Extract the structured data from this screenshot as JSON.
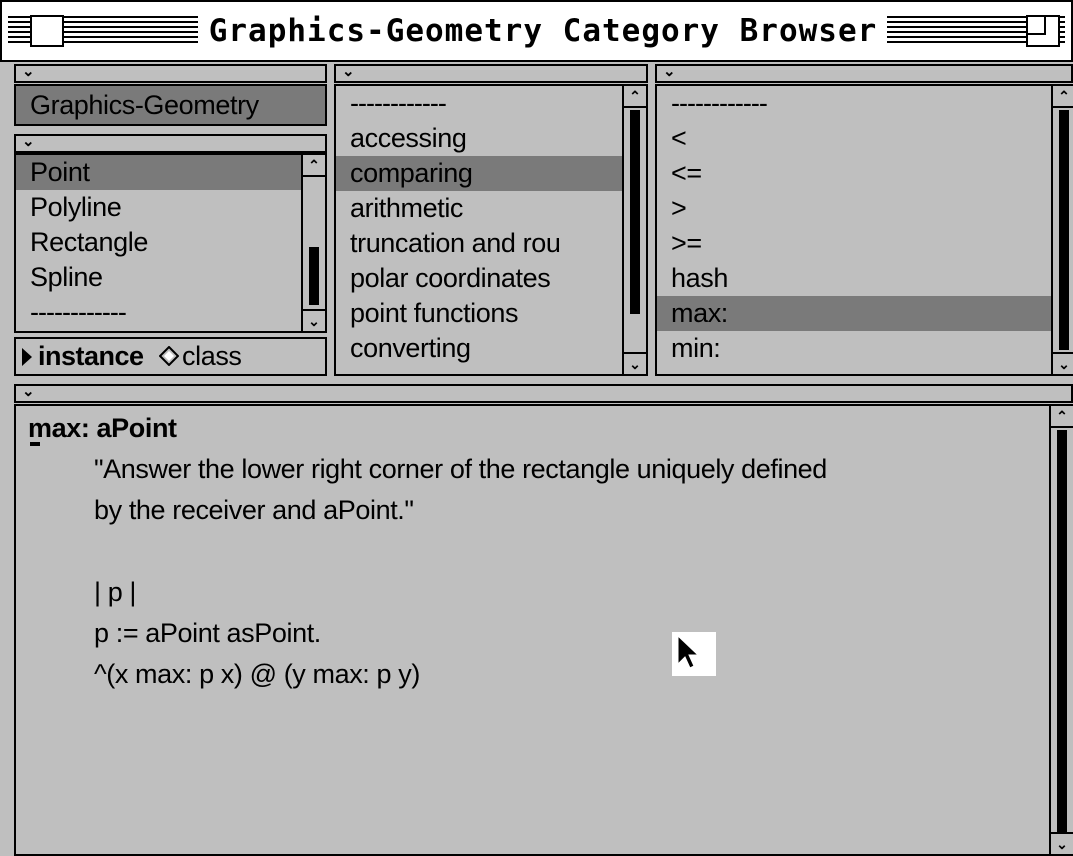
{
  "window": {
    "title": "Graphics-Geometry Category Browser"
  },
  "panes": {
    "categories": {
      "items": [
        "Graphics-Geometry"
      ],
      "selected": "Graphics-Geometry"
    },
    "classes": {
      "items": [
        "Point",
        "Polyline",
        "Rectangle",
        "Spline",
        "------------"
      ],
      "selected": "Point",
      "toggle": {
        "instance_label": "instance",
        "class_label": "class",
        "active": "instance"
      }
    },
    "protocols": {
      "items": [
        "------------",
        "accessing",
        "comparing",
        "arithmetic",
        "truncation and rou",
        "polar coordinates",
        "point functions",
        "converting"
      ],
      "selected": "comparing"
    },
    "methods": {
      "items": [
        "------------",
        "<",
        "<=",
        ">",
        ">=",
        "hash",
        "max:",
        "min:"
      ],
      "selected": "max:"
    }
  },
  "code": {
    "lines": [
      "max: aPoint",
      "\"Answer the lower right corner of the rectangle uniquely defined",
      "by the receiver and aPoint.\"",
      "",
      "| p |",
      "p := aPoint asPoint.",
      "^(x max: p x) @ (y max: p y)"
    ]
  },
  "icons": {
    "menu": "chevron-down-icon",
    "scroll_up": "scroll-up-arrow-icon",
    "scroll_down": "scroll-down-arrow-icon",
    "toggle": "triangle-right-icon",
    "radio": "diamond-radio-icon",
    "pointer": "arrow-cursor-icon"
  },
  "colors": {
    "pane_bg": "#bfbfbf",
    "selection": "#7a7a7a",
    "titlebar": "#ffffff",
    "text": "#000000"
  }
}
